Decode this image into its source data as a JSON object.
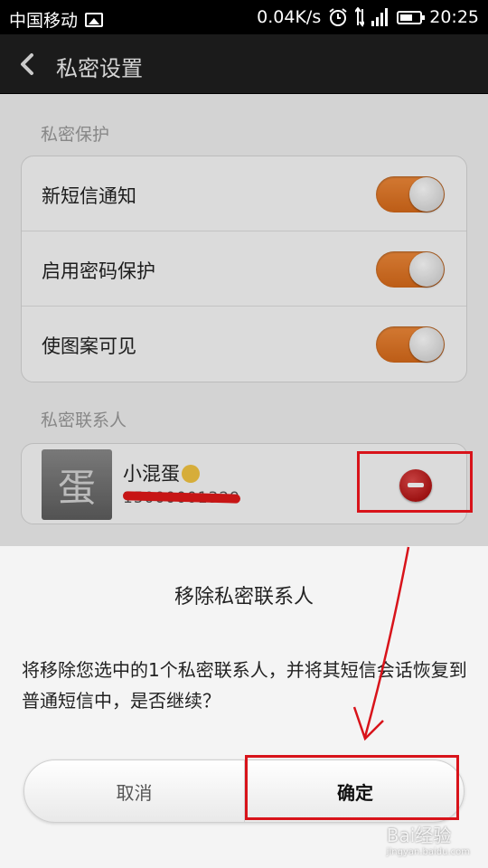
{
  "status_bar": {
    "carrier": "中国移动",
    "net_speed": "0.04K/s",
    "time": "20:25",
    "icons": [
      "image-icon",
      "alarm-icon",
      "signal-icon",
      "battery-icon"
    ]
  },
  "header": {
    "title": "私密设置",
    "back_icon": "chevron-left-icon"
  },
  "privacy_section": {
    "label": "私密保护",
    "toggles": [
      {
        "label": "新短信通知",
        "on": true
      },
      {
        "label": "启用密码保护",
        "on": true
      },
      {
        "label": "使图案可见",
        "on": true
      }
    ]
  },
  "contacts_section": {
    "label": "私密联系人",
    "contacts": [
      {
        "avatar_char": "蛋",
        "name": "小混蛋",
        "number": "15000001329",
        "number_redacted": true
      }
    ]
  },
  "dialog": {
    "title": "移除私密联系人",
    "message": "将移除您选中的1个私密联系人，并将其短信会话恢复到普通短信中，是否继续？",
    "cancel_label": "取消",
    "confirm_label": "确定"
  },
  "annotations": {
    "color": "#d8131a"
  },
  "watermark": {
    "text": "Bai经验",
    "sub": "jingyan.baidu.com"
  },
  "colors": {
    "toggle_on": "#e4762a",
    "title_bar": "#1f1f1f",
    "remove_button": "#c0181a"
  }
}
